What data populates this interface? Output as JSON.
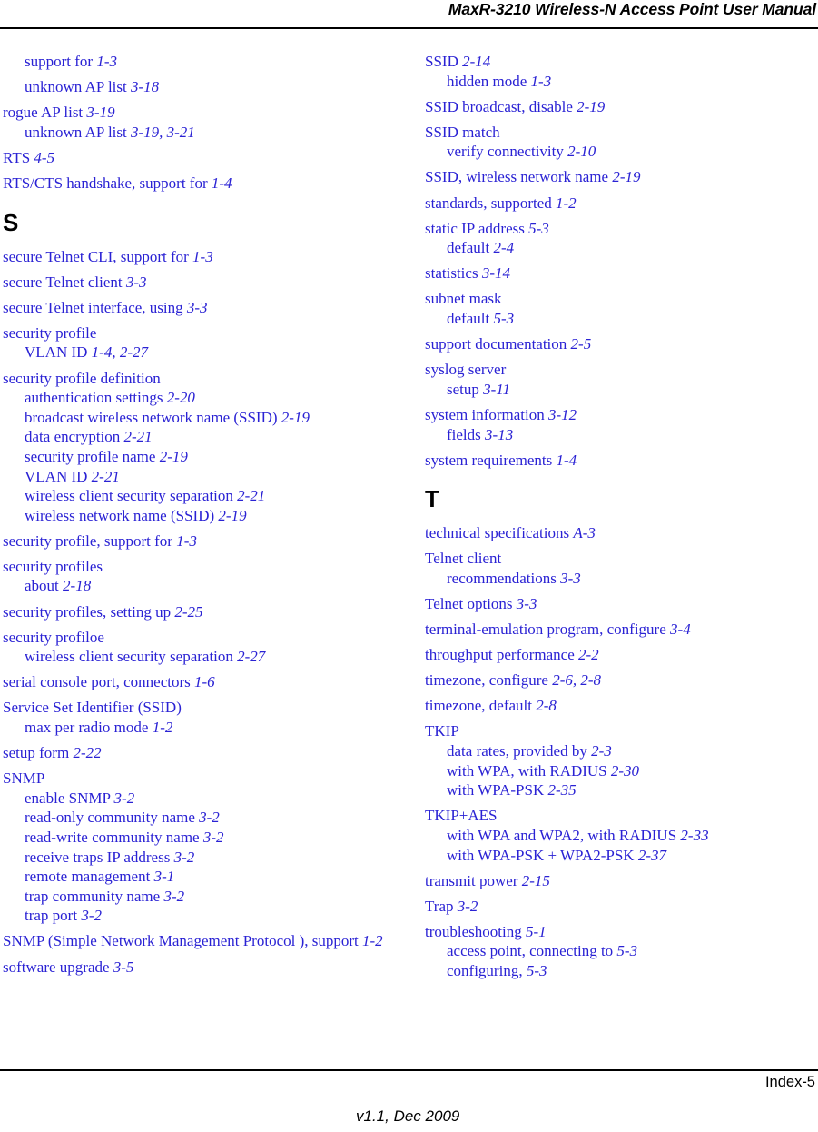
{
  "header": {
    "title": "MaxR-3210 Wireless-N Access Point User Manual"
  },
  "footer": {
    "page_number": "Index-5",
    "version": "v1.1, Dec 2009"
  },
  "columns": [
    {
      "id": "left",
      "blocks": [
        {
          "type": "entry",
          "lines": [
            {
              "indent": 1,
              "text": "support for ",
              "page": "1-3"
            }
          ]
        },
        {
          "type": "entry",
          "lines": [
            {
              "indent": 1,
              "text": "unknown AP list ",
              "page": "3-18"
            }
          ]
        },
        {
          "type": "entry",
          "lines": [
            {
              "indent": 0,
              "text": "rogue AP list ",
              "page": "3-19"
            },
            {
              "indent": 1,
              "text": "unknown AP list ",
              "page": "3-19, 3-21"
            }
          ]
        },
        {
          "type": "entry",
          "lines": [
            {
              "indent": 0,
              "text": "RTS ",
              "page": "4-5"
            }
          ]
        },
        {
          "type": "entry",
          "lines": [
            {
              "indent": 0,
              "text": "RTS/CTS handshake, support for ",
              "page": "1-4"
            }
          ]
        },
        {
          "type": "heading",
          "letter": "S"
        },
        {
          "type": "entry",
          "lines": [
            {
              "indent": 0,
              "text": "secure Telnet CLI, support for ",
              "page": "1-3"
            }
          ]
        },
        {
          "type": "entry",
          "lines": [
            {
              "indent": 0,
              "text": "secure Telnet client ",
              "page": "3-3"
            }
          ]
        },
        {
          "type": "entry",
          "lines": [
            {
              "indent": 0,
              "text": "secure Telnet interface, using ",
              "page": "3-3"
            }
          ]
        },
        {
          "type": "entry",
          "lines": [
            {
              "indent": 0,
              "text": "security profile",
              "page": ""
            },
            {
              "indent": 1,
              "text": "VLAN ID ",
              "page": "1-4, 2-27"
            }
          ]
        },
        {
          "type": "entry",
          "lines": [
            {
              "indent": 0,
              "text": "security profile definition",
              "page": ""
            },
            {
              "indent": 1,
              "text": "authentication settings ",
              "page": "2-20"
            },
            {
              "indent": 1,
              "text": "broadcast wireless network name (SSID) ",
              "page": "2-19"
            },
            {
              "indent": 1,
              "text": "data encryption ",
              "page": "2-21"
            },
            {
              "indent": 1,
              "text": "security profile name ",
              "page": "2-19"
            },
            {
              "indent": 1,
              "text": "VLAN ID ",
              "page": "2-21"
            },
            {
              "indent": 1,
              "text": "wireless client security separation ",
              "page": "2-21"
            },
            {
              "indent": 1,
              "text": "wireless network name (SSID) ",
              "page": "2-19"
            }
          ]
        },
        {
          "type": "entry",
          "lines": [
            {
              "indent": 0,
              "text": "security profile, support for ",
              "page": "1-3"
            }
          ]
        },
        {
          "type": "entry",
          "lines": [
            {
              "indent": 0,
              "text": "security profiles",
              "page": ""
            },
            {
              "indent": 1,
              "text": "about ",
              "page": "2-18"
            }
          ]
        },
        {
          "type": "entry",
          "lines": [
            {
              "indent": 0,
              "text": "security profiles, setting up ",
              "page": "2-25"
            }
          ]
        },
        {
          "type": "entry",
          "lines": [
            {
              "indent": 0,
              "text": "security profiloe",
              "page": ""
            },
            {
              "indent": 1,
              "text": "wireless client security separation ",
              "page": "2-27"
            }
          ]
        },
        {
          "type": "entry",
          "lines": [
            {
              "indent": 0,
              "text": "serial console port, connectors ",
              "page": "1-6"
            }
          ]
        },
        {
          "type": "entry",
          "lines": [
            {
              "indent": 0,
              "text": "Service Set Identifier (SSID)",
              "page": ""
            },
            {
              "indent": 1,
              "text": "max per radio mode ",
              "page": "1-2"
            }
          ]
        },
        {
          "type": "entry",
          "lines": [
            {
              "indent": 0,
              "text": "setup form ",
              "page": "2-22"
            }
          ]
        },
        {
          "type": "entry",
          "lines": [
            {
              "indent": 0,
              "text": "SNMP",
              "page": ""
            },
            {
              "indent": 1,
              "text": "enable SNMP ",
              "page": "3-2"
            },
            {
              "indent": 1,
              "text": "read-only community name ",
              "page": "3-2"
            },
            {
              "indent": 1,
              "text": "read-write community name ",
              "page": "3-2"
            },
            {
              "indent": 1,
              "text": "receive traps IP address ",
              "page": "3-2"
            },
            {
              "indent": 1,
              "text": "remote management ",
              "page": "3-1"
            },
            {
              "indent": 1,
              "text": "trap community name ",
              "page": "3-2"
            },
            {
              "indent": 1,
              "text": "trap port ",
              "page": "3-2"
            }
          ]
        },
        {
          "type": "entry",
          "lines": [
            {
              "indent": 0,
              "text": "SNMP (Simple Network Management Protocol ), support ",
              "page": "1-2"
            }
          ]
        },
        {
          "type": "entry",
          "lines": [
            {
              "indent": 0,
              "text": "software upgrade ",
              "page": "3-5"
            }
          ]
        }
      ]
    },
    {
      "id": "right",
      "blocks": [
        {
          "type": "entry",
          "lines": [
            {
              "indent": 0,
              "text": "SSID ",
              "page": "2-14"
            },
            {
              "indent": 1,
              "text": "hidden mode ",
              "page": "1-3"
            }
          ]
        },
        {
          "type": "entry",
          "lines": [
            {
              "indent": 0,
              "text": "SSID broadcast, disable ",
              "page": "2-19"
            }
          ]
        },
        {
          "type": "entry",
          "lines": [
            {
              "indent": 0,
              "text": "SSID match",
              "page": ""
            },
            {
              "indent": 1,
              "text": "verify connectivity ",
              "page": "2-10"
            }
          ]
        },
        {
          "type": "entry",
          "lines": [
            {
              "indent": 0,
              "text": "SSID, wireless network name ",
              "page": "2-19"
            }
          ]
        },
        {
          "type": "entry",
          "lines": [
            {
              "indent": 0,
              "text": "standards, supported ",
              "page": "1-2"
            }
          ]
        },
        {
          "type": "entry",
          "lines": [
            {
              "indent": 0,
              "text": "static IP address ",
              "page": "5-3"
            },
            {
              "indent": 1,
              "text": "default ",
              "page": "2-4"
            }
          ]
        },
        {
          "type": "entry",
          "lines": [
            {
              "indent": 0,
              "text": "statistics ",
              "page": "3-14"
            }
          ]
        },
        {
          "type": "entry",
          "lines": [
            {
              "indent": 0,
              "text": "subnet mask",
              "page": ""
            },
            {
              "indent": 1,
              "text": "default ",
              "page": "5-3"
            }
          ]
        },
        {
          "type": "entry",
          "lines": [
            {
              "indent": 0,
              "text": "support documentation ",
              "page": "2-5"
            }
          ]
        },
        {
          "type": "entry",
          "lines": [
            {
              "indent": 0,
              "text": "syslog server",
              "page": ""
            },
            {
              "indent": 1,
              "text": "setup ",
              "page": "3-11"
            }
          ]
        },
        {
          "type": "entry",
          "lines": [
            {
              "indent": 0,
              "text": "system information ",
              "page": "3-12"
            },
            {
              "indent": 1,
              "text": "fields ",
              "page": "3-13"
            }
          ]
        },
        {
          "type": "entry",
          "lines": [
            {
              "indent": 0,
              "text": "system requirements ",
              "page": "1-4"
            }
          ]
        },
        {
          "type": "heading",
          "letter": "T"
        },
        {
          "type": "entry",
          "lines": [
            {
              "indent": 0,
              "text": "technical specifications ",
              "page": "A-3"
            }
          ]
        },
        {
          "type": "entry",
          "lines": [
            {
              "indent": 0,
              "text": "Telnet client",
              "page": ""
            },
            {
              "indent": 1,
              "text": "recommendations ",
              "page": "3-3"
            }
          ]
        },
        {
          "type": "entry",
          "lines": [
            {
              "indent": 0,
              "text": "Telnet options ",
              "page": "3-3"
            }
          ]
        },
        {
          "type": "entry",
          "lines": [
            {
              "indent": 0,
              "text": "terminal-emulation program, configure ",
              "page": "3-4"
            }
          ]
        },
        {
          "type": "entry",
          "lines": [
            {
              "indent": 0,
              "text": "throughput performance ",
              "page": "2-2"
            }
          ]
        },
        {
          "type": "entry",
          "lines": [
            {
              "indent": 0,
              "text": "timezone, configure ",
              "page": "2-6, 2-8"
            }
          ]
        },
        {
          "type": "entry",
          "lines": [
            {
              "indent": 0,
              "text": "timezone, default ",
              "page": "2-8"
            }
          ]
        },
        {
          "type": "entry",
          "lines": [
            {
              "indent": 0,
              "text": "TKIP",
              "page": ""
            },
            {
              "indent": 1,
              "text": "data rates, provided by ",
              "page": "2-3"
            },
            {
              "indent": 1,
              "text": "with WPA, with RADIUS ",
              "page": "2-30"
            },
            {
              "indent": 1,
              "text": "with WPA-PSK ",
              "page": "2-35"
            }
          ]
        },
        {
          "type": "entry",
          "lines": [
            {
              "indent": 0,
              "text": "TKIP+AES",
              "page": ""
            },
            {
              "indent": 1,
              "text": "with WPA and WPA2, with RADIUS ",
              "page": "2-33"
            },
            {
              "indent": 1,
              "text": "with WPA-PSK + WPA2-PSK ",
              "page": "2-37"
            }
          ]
        },
        {
          "type": "entry",
          "lines": [
            {
              "indent": 0,
              "text": "transmit power ",
              "page": "2-15"
            }
          ]
        },
        {
          "type": "entry",
          "lines": [
            {
              "indent": 0,
              "text": "Trap ",
              "page": "3-2"
            }
          ]
        },
        {
          "type": "entry",
          "lines": [
            {
              "indent": 0,
              "text": "troubleshooting ",
              "page": "5-1"
            },
            {
              "indent": 1,
              "text": "access point, connecting to ",
              "page": "5-3"
            },
            {
              "indent": 1,
              "text": "configuring, ",
              "page": "5-3"
            }
          ]
        }
      ]
    }
  ],
  "colors": {
    "entry_text": "#2a22d4",
    "heading_text": "#000000",
    "rule": "#000000",
    "background": "#ffffff"
  }
}
